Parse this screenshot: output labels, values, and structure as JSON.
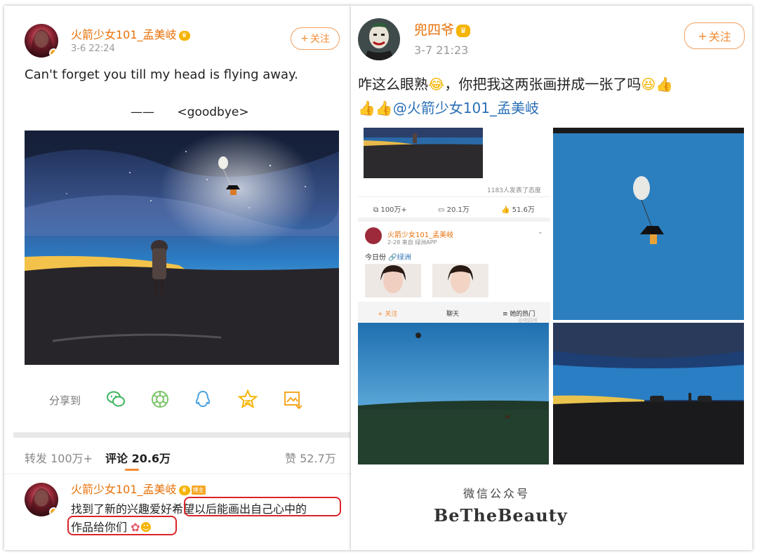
{
  "left_post": {
    "username": "火箭少女101_孟美岐",
    "crown_icon": "crown-icon",
    "time": "3-6 22:24",
    "follow_label": "关注",
    "text_line1": "Can't forget you till my head is flying away.",
    "text_line2": "——      <goodbye>",
    "share_label": "分享到",
    "share_icons": [
      "wechat-icon",
      "moments-icon",
      "qq-icon",
      "qzone-icon",
      "save-image-icon"
    ],
    "stats": {
      "repost": "转发 100万+",
      "comment": "评论 20.6万",
      "like": "赞 52.7万"
    },
    "comment": {
      "username": "火箭少女101_孟美岐",
      "host_badge": "博主",
      "text_line1_a": "找到了新的兴趣爱好",
      "text_line1_b": "希望以后能画出自己心中的",
      "text_line2": "作品给你们"
    }
  },
  "right_post": {
    "username": "兜四爷",
    "time": "3-7 21:23",
    "follow_label": "关注",
    "text_line1": "咋这么眼熟",
    "text_line1_b": "，你把我这两张画拼成一张了吗",
    "mention": "@火箭少女101_孟美岐",
    "embedded": {
      "people_count": "1183人发表了态度",
      "repost": "100万+",
      "comment": "20.1万",
      "like": "51.6万",
      "username": "火箭少女101_孟美岐",
      "meta": "2-28  来自 绿洲APP",
      "text": "今日份",
      "link": "绿洲",
      "follow": "关注",
      "chat": "聊天",
      "hot": "她的热门",
      "credit": "@兜四爷"
    }
  },
  "watermark": {
    "line1": "微信公众号",
    "line2": "BeTheBeauty"
  },
  "colors": {
    "accent": "#f08a34",
    "username": "#e8710a",
    "mention": "#2a6fb5",
    "highlight": "#d9252a"
  }
}
